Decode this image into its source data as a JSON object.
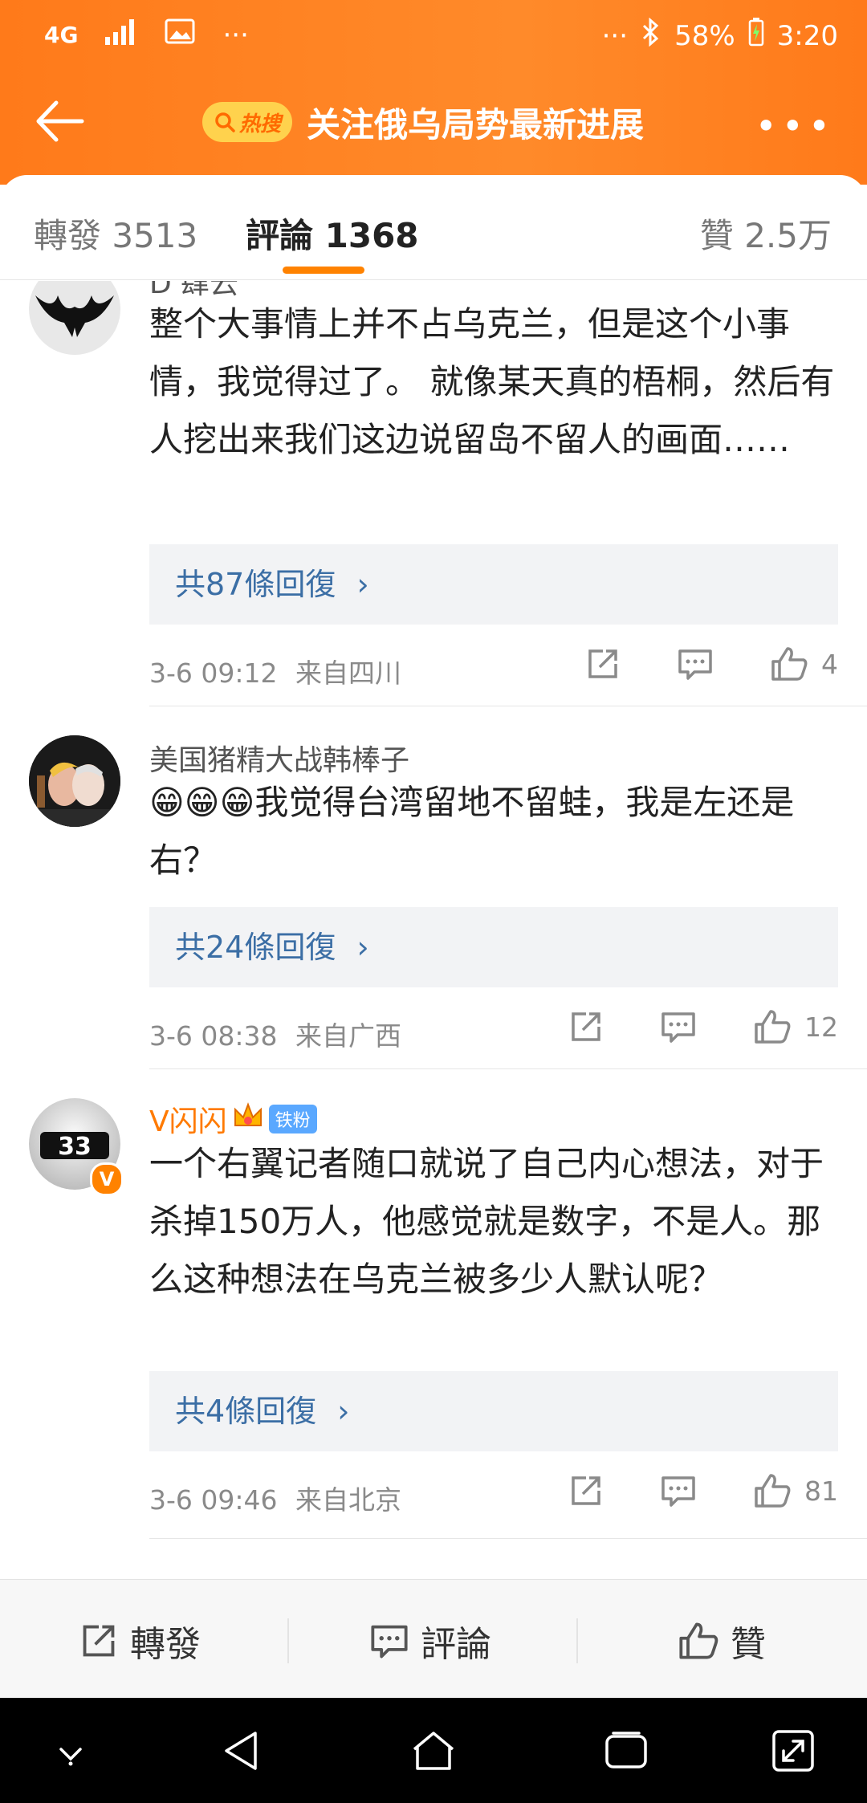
{
  "status": {
    "network": "4G",
    "dots": "···",
    "right_dots": "···",
    "battery": "58%",
    "time": "3:20"
  },
  "nav": {
    "hot_label": "热搜",
    "title": "关注俄乌局势最新进展",
    "more": "•••"
  },
  "tabs": {
    "repost": "轉發 3513",
    "comments": "評論 1368",
    "likes": "贊 2.5万"
  },
  "comments": [
    {
      "username": "D 肆云",
      "text": "整个大事情上并不占乌克兰，但是这个小事情，我觉得过了。 就像某天真的梧桐，然后有人挖出来我们这边说留岛不留人的画面……",
      "replies": "共87條回復",
      "time": "3-6 09:12",
      "location": "来自四川",
      "likes": "4"
    },
    {
      "username": "美国猪精大战韩棒子",
      "text": "😁😁😁我觉得台湾留地不留蛙，我是左还是右？",
      "replies": "共24條回復",
      "time": "3-6 08:38",
      "location": "来自广西",
      "likes": "12"
    },
    {
      "username": "V闪闪",
      "badge": "铁粉",
      "text": "一个右翼记者随口就说了自己内心想法，对于杀掉150万人，他感觉就是数字，不是人。那么这种想法在乌克兰被多少人默认呢？",
      "replies": "共4條回復",
      "time": "3-6 09:46",
      "location": "来自北京",
      "likes": "81"
    }
  ],
  "bottom": {
    "repost": "轉發",
    "comment": "評論",
    "like": "贊"
  },
  "colors": {
    "accent": "#ff8200",
    "header": "#ff7a1a",
    "link": "#3b6ea5"
  }
}
